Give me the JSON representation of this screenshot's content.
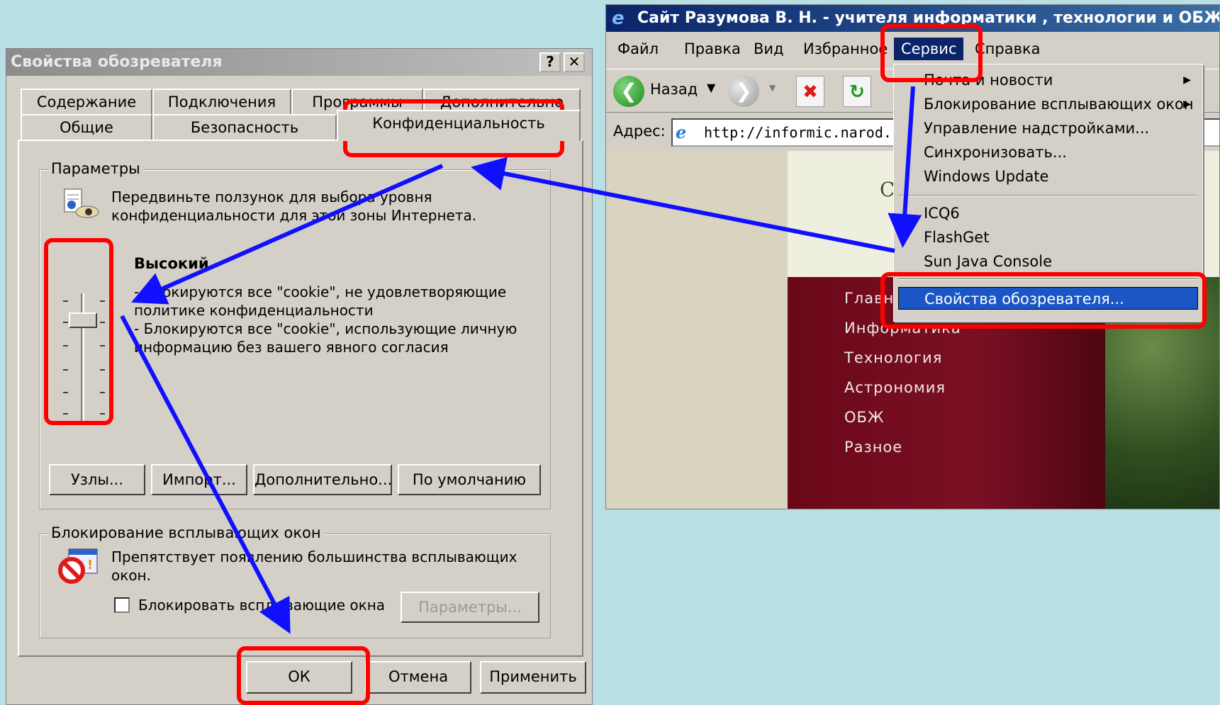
{
  "browser": {
    "title": "Сайт Разумова В. Н. - учителя информатики , технологии и ОБЖ - Micros",
    "menu": [
      "Файл",
      "Правка",
      "Вид",
      "Избранное",
      "Сервис",
      "Справка"
    ],
    "active_menu": "Сервис",
    "toolbar": {
      "back_label": "Назад"
    },
    "address": {
      "label": "Адрес:",
      "url": "http://informic.narod.ru/"
    },
    "nav_items": [
      "Главная",
      "Информатика",
      "Технология",
      "Астрономия",
      "ОБЖ",
      "Разное"
    ],
    "header_partial": "С"
  },
  "service_menu": {
    "items": [
      {
        "label": "Почта и новости",
        "submenu": true
      },
      {
        "label": "Блокирование всплывающих окон",
        "submenu": true
      },
      {
        "label": "Управление надстройками...",
        "submenu": false
      },
      {
        "label": "Синхронизовать...",
        "submenu": false
      },
      {
        "label": "Windows Update",
        "submenu": false
      },
      {
        "label": "ICQ6",
        "submenu": false
      },
      {
        "label": "FlashGet",
        "submenu": false
      },
      {
        "label": "Sun Java Console",
        "submenu": false
      },
      {
        "label": "Свойства обозревателя...",
        "submenu": false,
        "selected": true
      }
    ]
  },
  "dialog": {
    "title": "Свойства обозревателя",
    "help_btn": "?",
    "close_btn": "✕",
    "tabs_row1": [
      "Содержание",
      "Подключения",
      "Программы",
      "Дополнительно"
    ],
    "tabs_row2": [
      "Общие",
      "Безопасность",
      "Конфиденциальность"
    ],
    "active_tab": "Конфиденциальность",
    "params": {
      "legend": "Параметры",
      "hint_line1": "Передвиньте ползунок для выбора уровня",
      "hint_line2": "конфиденциальности для этой зоны Интернета.",
      "level_title": "Высокий",
      "desc_line1": "- Блокируются все \"cookie\", не удовлетворяющие",
      "desc_line2": "политике конфиденциальности",
      "desc_line3": "- Блокируются все \"cookie\", использующие личную",
      "desc_line4": "информацию без вашего явного согласия",
      "slider_level": "5 of 6 positions (second from top)",
      "buttons": [
        "Узлы...",
        "Импорт...",
        "Дополнительно...",
        "По умолчанию"
      ]
    },
    "popup": {
      "legend": "Блокирование всплывающих окон",
      "desc_line1": "Препятствует появлению большинства всплывающих",
      "desc_line2": "окон.",
      "checkbox_label": "Блокировать всплывающие окна",
      "checked": false,
      "settings_btn": "Параметры..."
    },
    "footer_buttons": [
      "ОК",
      "Отмена",
      "Применить"
    ]
  },
  "colors": {
    "background": "#b8e0e4",
    "annotation_red": "#ff0000",
    "annotation_arrow": "#1010ff",
    "menu_highlight": "#1a56c6",
    "title_active": "#0a246a"
  }
}
